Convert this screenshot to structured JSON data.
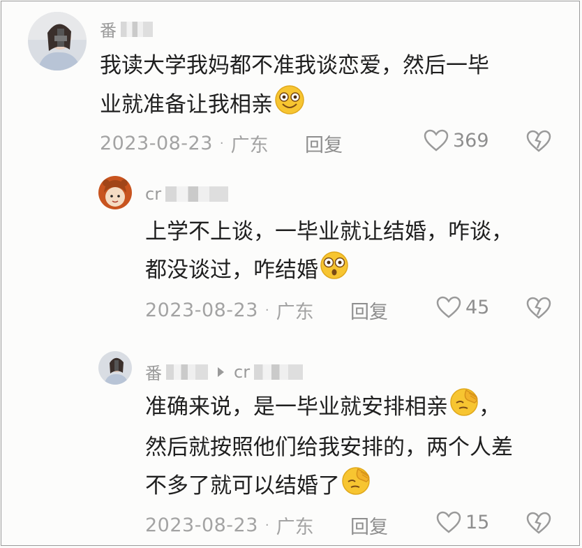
{
  "comments": [
    {
      "username": "番",
      "text_lines": [
        "我读大学我妈都不准我谈恋爱，然后一毕",
        "业就准备让我相亲"
      ],
      "emoji": "smiling-face-emoji",
      "date": "2023-08-23",
      "location": "广东",
      "reply_label": "回复",
      "likes": "369"
    },
    {
      "username": "cr",
      "text_lines": [
        "上学不上谈，一毕业就让结婚，咋谈，",
        "都没谈过，咋结婚"
      ],
      "emoji": "flushed-face-emoji",
      "date": "2023-08-23",
      "location": "广东",
      "reply_label": "回复",
      "likes": "45"
    },
    {
      "username": "番",
      "reply_to": "cr",
      "text_lines": [
        "准确来说，是一毕业就安排相亲",
        "，",
        "然后就按照他们给我安排的，两个人差",
        "不多了就可以结婚了"
      ],
      "emoji": "facepalm-emoji",
      "date": "2023-08-23",
      "location": "广东",
      "reply_label": "回复",
      "likes": "15"
    }
  ],
  "colors": {
    "background": "#fcfcfb",
    "meta_gray": "#a3a3a3",
    "emoji_yellow": "#f7c531"
  }
}
